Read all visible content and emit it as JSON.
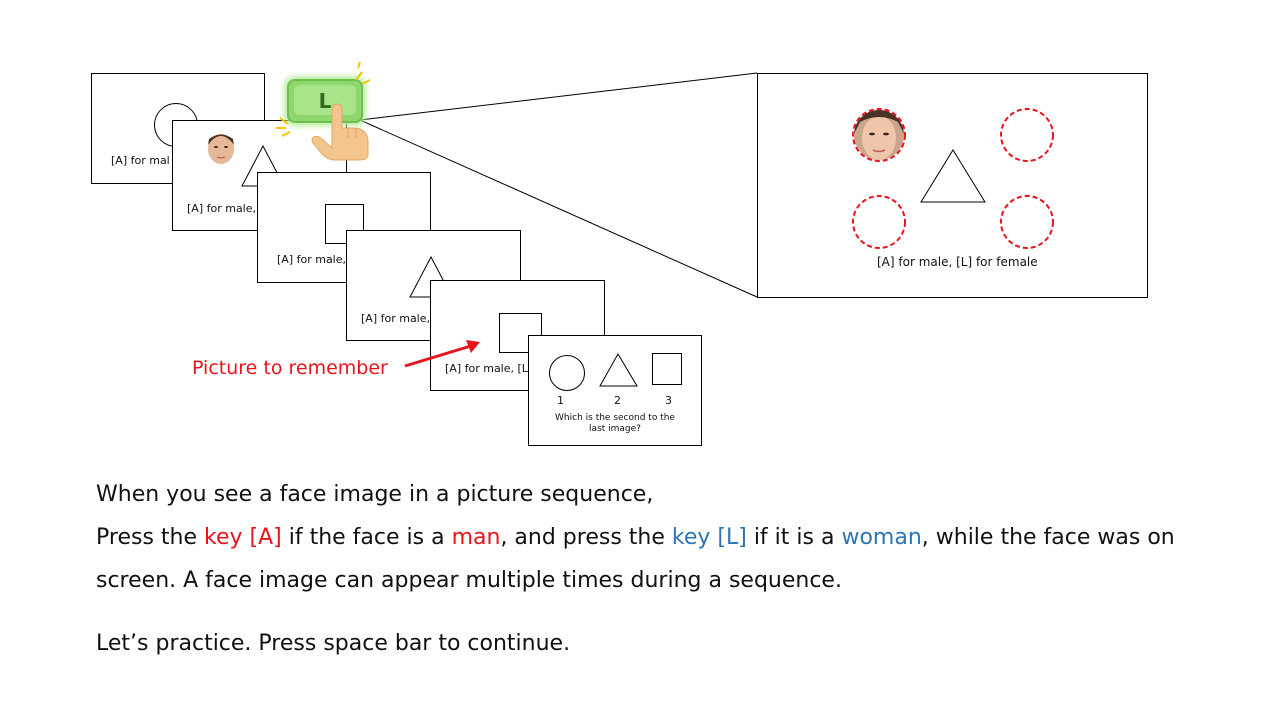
{
  "slide": {
    "card_caption_1": "[A] for mal",
    "card_caption_2": "[A] for male,",
    "card_caption_3": "[A] for male,",
    "card_caption_4": "[A] for male,",
    "card_caption_5": "[A] for male, [L",
    "zoom_caption": "[A] for male,  [L] for female",
    "key_label": "L",
    "picture_label": "Picture to remember",
    "question": {
      "options": [
        "1",
        "2",
        "3"
      ],
      "text_line1": "Which is the second to the",
      "text_line2": "last image?"
    },
    "instructions": {
      "line1": "When you see a face image in a picture sequence,",
      "line2": {
        "p1": "Press the ",
        "key_a": "key [A]",
        "p2": " if the face is a ",
        "man": "man",
        "p3": ", and press the ",
        "key_l": "key [L]",
        "p4": " if it is a ",
        "woman": "woman",
        "p5": ", while the face was on"
      },
      "line3": "screen. A face image can appear multiple times during a sequence.",
      "line4": "Let’s practice. Press space bar to continue."
    },
    "colors": {
      "red": "#e8141b",
      "blue": "#2e75b6",
      "key_green": "#8fd66f"
    }
  }
}
